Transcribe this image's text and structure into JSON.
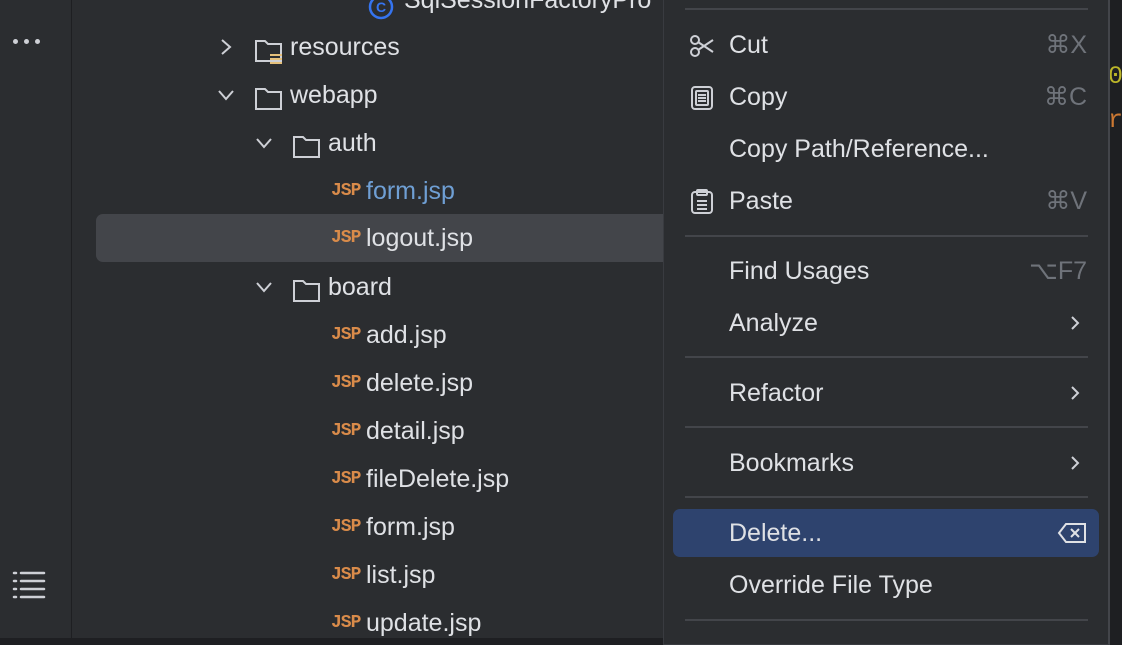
{
  "tree": {
    "top_partial_label": "SqlSessionFactoryPro",
    "items": [
      {
        "label": "resources",
        "kind": "folder-resources",
        "expanded": false
      },
      {
        "label": "webapp",
        "kind": "folder",
        "expanded": true
      },
      {
        "label": "auth",
        "kind": "folder",
        "expanded": true
      },
      {
        "label": "form.jsp",
        "kind": "jsp",
        "modified": true
      },
      {
        "label": "logout.jsp",
        "kind": "jsp",
        "selected": true
      },
      {
        "label": "board",
        "kind": "folder",
        "expanded": true
      },
      {
        "label": "add.jsp",
        "kind": "jsp"
      },
      {
        "label": "delete.jsp",
        "kind": "jsp"
      },
      {
        "label": "detail.jsp",
        "kind": "jsp"
      },
      {
        "label": "fileDelete.jsp",
        "kind": "jsp"
      },
      {
        "label": "form.jsp",
        "kind": "jsp"
      },
      {
        "label": "list.jsp",
        "kind": "jsp"
      },
      {
        "label": "update.jsp",
        "kind": "jsp"
      }
    ],
    "jsp_badge": "JSP"
  },
  "menu": {
    "items": [
      {
        "label": "Cut",
        "shortcut": "⌘X",
        "icon": "scissors-icon"
      },
      {
        "label": "Copy",
        "shortcut": "⌘C",
        "icon": "copy-icon"
      },
      {
        "label": "Copy Path/Reference...",
        "shortcut": ""
      },
      {
        "label": "Paste",
        "shortcut": "⌘V",
        "icon": "paste-icon"
      },
      {
        "label": "Find Usages",
        "shortcut": "⌥F7"
      },
      {
        "label": "Analyze",
        "submenu": true
      },
      {
        "label": "Refactor",
        "submenu": true
      },
      {
        "label": "Bookmarks",
        "submenu": true
      },
      {
        "label": "Delete...",
        "active": true,
        "shortcut_icon": "delete-key-icon"
      },
      {
        "label": "Override File Type"
      }
    ]
  },
  "editor": {
    "chars": [
      "0",
      "r"
    ]
  },
  "colors": {
    "panel_bg": "#2b2d30",
    "selection": "#43454a",
    "menu_active": "#2e436e",
    "jsp_orange": "#d98b4a",
    "modified_blue": "#6f9fd4",
    "class_icon_blue": "#3574f0"
  }
}
